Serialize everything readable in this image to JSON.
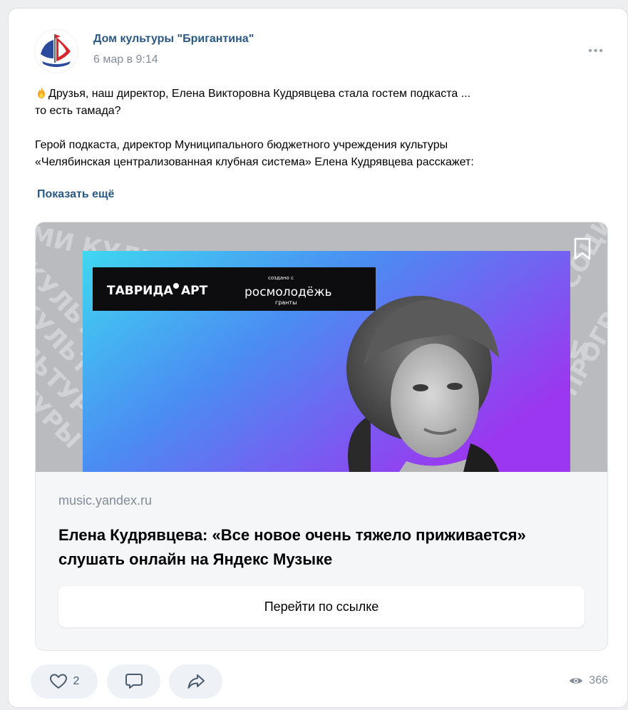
{
  "post": {
    "author": "Дом культуры \"Бригантина\"",
    "date": "6 мар в 9:14",
    "text_lines": [
      "Друзья, наш директор, Елена Викторовна Кудрявцева стала гостем подкаста ...",
      "то есть тамада?",
      "Герой подкаста, директор Муниципального бюджетного учреждения культуры",
      "«Челябинская централизованная клубная система» Елена Кудрявцева расскажет:"
    ],
    "show_more": "Показать ещё"
  },
  "link_card": {
    "banner": {
      "brand": "ТАВРИДА",
      "brand_suffix": "АРТ",
      "created_with": "создано с",
      "partner": "росмолодёжь",
      "partner_sub": "гранты",
      "bg_words": "КУЛЬТУРЫ ЦИКЛ ПОДКАСТОВ СОЦИАЛЬНАЯ ИНДУСТРИЯ ПРОГРАММИ"
    },
    "domain": "music.yandex.ru",
    "title": "Елена Кудрявцева: «Все новое очень тяжело приживается» слушать онлайн на Яндекс Музыке",
    "button": "Перейти по ссылке"
  },
  "actions": {
    "likes": "2",
    "views": "366"
  },
  "icons": {
    "like": "heart-icon",
    "comment": "comment-icon",
    "share": "share-icon",
    "views": "eye-icon",
    "more": "more-dots-icon",
    "bookmark": "bookmark-icon",
    "emoji": "fire-icon"
  },
  "colors": {
    "link": "#2a5885",
    "secondary": "#818c99",
    "action_bg": "#eef1f6",
    "banner_gradient_start": "#3fd7f0",
    "banner_gradient_end": "#9b37f0"
  }
}
